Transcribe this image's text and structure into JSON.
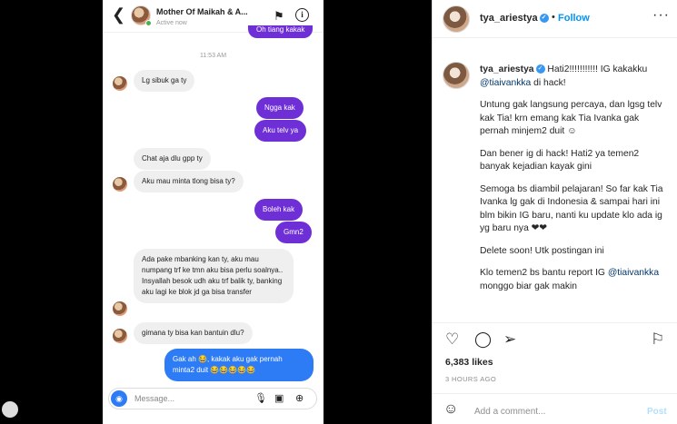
{
  "chat": {
    "contact_name": "Mother Of Maikah & A...",
    "status": "Active now",
    "top_bubble": "Oh tiang kakak",
    "timestamp": "11:53 AM",
    "messages": [
      {
        "side": "in",
        "text": "Lg sibuk ga ty"
      },
      {
        "side": "out",
        "text": "Ngga kak"
      },
      {
        "side": "out",
        "text": "Aku telv ya"
      },
      {
        "side": "in",
        "text": "Chat aja dlu gpp ty"
      },
      {
        "side": "in",
        "text": "Aku mau minta tlong bisa ty?"
      },
      {
        "side": "out",
        "text": "Boleh kak"
      },
      {
        "side": "out",
        "text": "Gmn2"
      },
      {
        "side": "in",
        "text": "Ada pake mbanking kan ty, aku mau numpang trf ke tmn aku bisa perlu soalnya.. Insyallah besok udh aku trf balik ty, banking aku lagi ke blok jd ga bisa transfer"
      },
      {
        "side": "in",
        "text": "gimana ty bisa kan bantuin dlu?"
      },
      {
        "side": "out_blue",
        "text": "Gak ah 😂, kakak aku gak pernah minta2 duit 😂😂😂😂😂"
      }
    ],
    "composer_placeholder": "Message..."
  },
  "post": {
    "username": "tya_ariestya",
    "follow_label": "Follow",
    "caption_parts": {
      "p1_text": " Hati2!!!!!!!!!!! IG kakakku ",
      "p1_mention": "@tiaivankka",
      "p1_end": " di hack!",
      "p2": "Untung gak langsung percaya, dan lgsg telv kak Tia! krn emang kak Tia Ivanka gak pernah minjem2 duit ☺",
      "p3": "Dan bener ig di hack! Hati2 ya temen2 banyak kejadian kayak gini",
      "p4": "Semoga bs diambil pelajaran! So far kak Tia Ivanka lg gak di Indonesia & sampai hari ini blm bikin IG baru, nanti ku update klo ada ig yg baru nya ❤❤",
      "p5": "Delete soon! Utk postingan ini",
      "p6_text": "Klo temen2 bs bantu report IG ",
      "p6_mention": "@tiaivankka",
      "p6_end": " monggo biar gak makin"
    },
    "likes": "6,383 likes",
    "time_ago": "3 HOURS AGO",
    "comment_placeholder": "Add a comment...",
    "post_label": "Post"
  },
  "colors": {
    "outgoing_bubble": "#6f2fd6",
    "outgoing_blue": "#2d7cf6",
    "incoming_bubble": "#efefef",
    "follow_blue": "#0095f6"
  }
}
